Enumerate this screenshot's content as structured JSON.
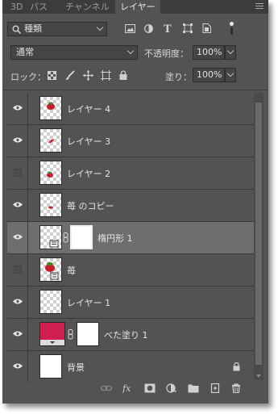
{
  "tabs": [
    "3D",
    "パス",
    "チャンネル",
    "レイヤー"
  ],
  "filter": {
    "kind_label": "種類"
  },
  "blend": {
    "mode": "通常",
    "opacity_label": "不透明度：",
    "opacity": "100%"
  },
  "lock": {
    "label": "ロック：",
    "fill_label": "塗り：",
    "fill": "100%"
  },
  "layers": [
    {
      "name": "レイヤー 4",
      "visible": true
    },
    {
      "name": "レイヤー 3",
      "visible": true
    },
    {
      "name": "レイヤー 2",
      "visible": false
    },
    {
      "name": "苺 のコピー",
      "visible": true
    },
    {
      "name": "楕円形 1",
      "visible": true,
      "selected": true
    },
    {
      "name": "苺",
      "visible": false
    },
    {
      "name": "レイヤー 1",
      "visible": true
    },
    {
      "name": "べた塗り 1",
      "visible": true
    },
    {
      "name": "背景",
      "visible": true
    }
  ],
  "colors": {
    "panel": "#535353",
    "fill_layer": "#d01e4e"
  }
}
